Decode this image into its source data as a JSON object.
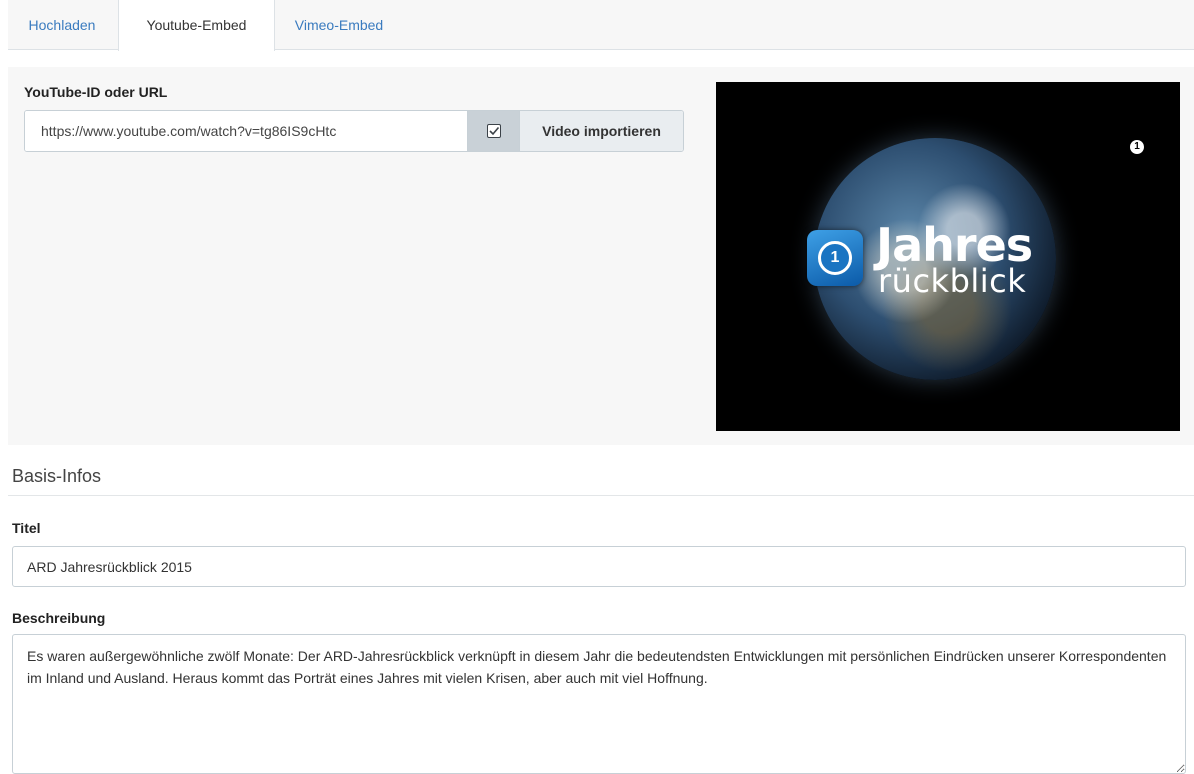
{
  "tabs": [
    {
      "label": "Hochladen",
      "active": false
    },
    {
      "label": "Youtube-Embed",
      "active": true
    },
    {
      "label": "Vimeo-Embed",
      "active": false
    }
  ],
  "youtube": {
    "label": "YouTube-ID oder URL",
    "url_value": "https://www.youtube.com/watch?v=tg86IS9cHtc",
    "checkbox_checked": true,
    "import_button": "Video importieren"
  },
  "preview": {
    "title_line1": "Jahres",
    "title_line2": "rückblick",
    "logo_glyph": "1",
    "channel_bug": "1"
  },
  "basis": {
    "section_title": "Basis-Infos",
    "title_label": "Titel",
    "title_value": "ARD Jahresrückblick 2015",
    "description_label": "Beschreibung",
    "description_value": "Es waren außergewöhnliche zwölf Monate: Der ARD-Jahresrückblick verknüpft in diesem Jahr die bedeutendsten Entwicklungen mit persönlichen Eindrücken unserer Korrespondenten im Inland und Ausland. Heraus kommt das Porträt eines Jahres mit vielen Krisen, aber auch mit viel Hoffnung."
  },
  "colors": {
    "link": "#3a7bbf",
    "tab_bar_bg": "#f7f7f7",
    "addon_bg": "#c9d1d7"
  }
}
